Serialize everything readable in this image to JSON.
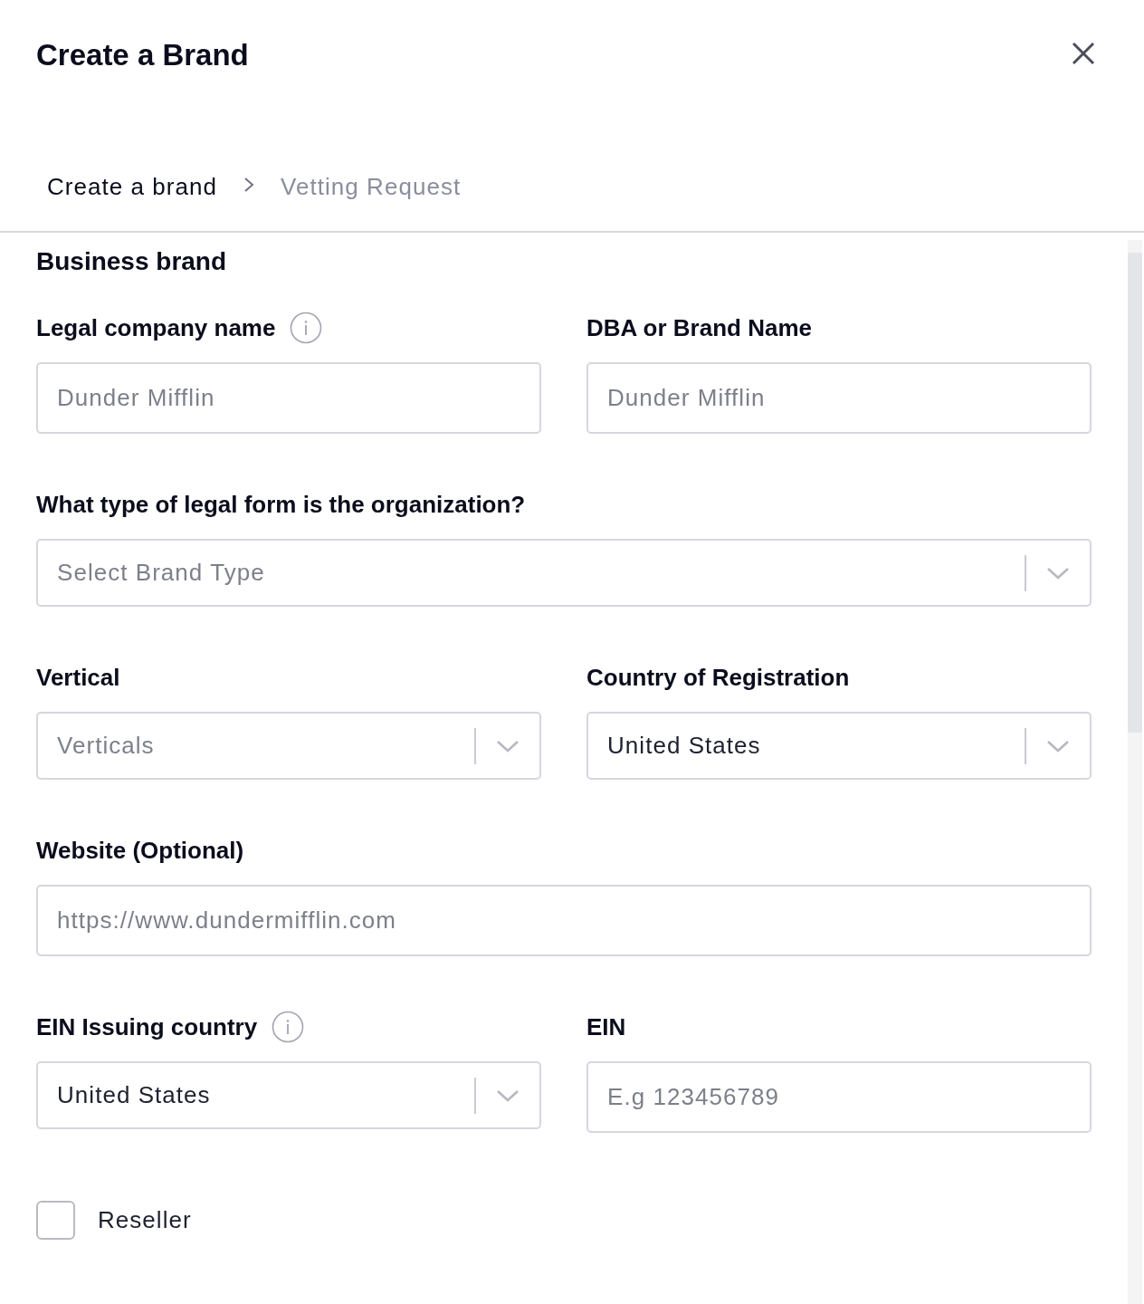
{
  "header": {
    "title": "Create a Brand"
  },
  "breadcrumb": [
    {
      "label": "Create a brand",
      "selected": true
    },
    {
      "label": "Vetting Request",
      "selected": false
    }
  ],
  "section_title": "Business brand",
  "rows": [
    [
      {
        "kind": "text",
        "label": "Legal company name",
        "info": true,
        "placeholder": "Dunder Mifflin"
      },
      {
        "kind": "text",
        "label": "DBA or Brand Name",
        "info": false,
        "placeholder": "Dunder Mifflin"
      }
    ],
    [
      {
        "kind": "select",
        "label": "What type of legal form is the organization?",
        "info": false,
        "placeholder": "Select Brand Type"
      }
    ],
    [
      {
        "kind": "select",
        "label": "Vertical",
        "info": false,
        "placeholder": "Verticals"
      },
      {
        "kind": "select",
        "label": "Country of Registration",
        "info": false,
        "value": "United States"
      }
    ],
    [
      {
        "kind": "text",
        "label": "Website (Optional)",
        "info": false,
        "placeholder": "https://www.dundermifflin.com"
      }
    ],
    [
      {
        "kind": "select",
        "label": "EIN Issuing country",
        "info": true,
        "value": "United States"
      },
      {
        "kind": "text",
        "label": "EIN",
        "info": false,
        "placeholder": "E.g 123456789"
      }
    ]
  ],
  "reseller": {
    "label": "Reseller",
    "checked": false
  }
}
